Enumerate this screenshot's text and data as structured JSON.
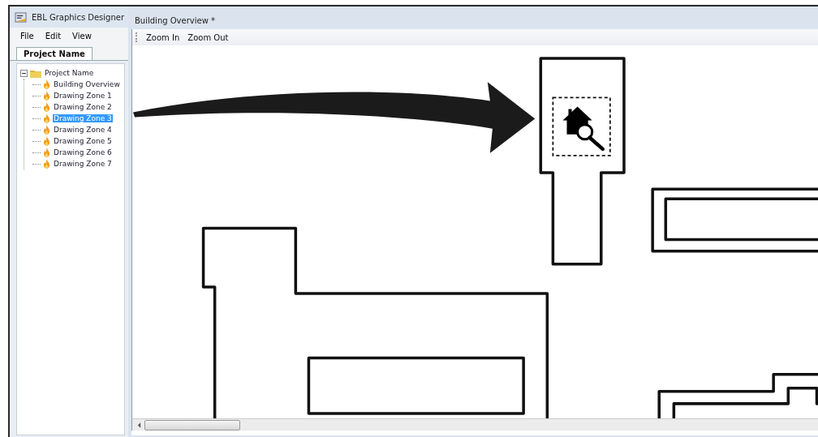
{
  "app": {
    "title": "EBL Graphics Designer",
    "menu": [
      "File",
      "Edit",
      "View"
    ],
    "tabs": [
      {
        "label": "Project Name",
        "selected": true
      }
    ]
  },
  "tree": {
    "label": "Project Name",
    "expanded": true,
    "children": [
      {
        "label": "Building Overview",
        "selected": false
      },
      {
        "label": "Drawing Zone 1",
        "selected": false
      },
      {
        "label": "Drawing Zone 2",
        "selected": false
      },
      {
        "label": "Drawing Zone 3",
        "selected": true
      },
      {
        "label": "Drawing Zone 4",
        "selected": false
      },
      {
        "label": "Drawing Zone 5",
        "selected": false
      },
      {
        "label": "Drawing Zone 6",
        "selected": false
      },
      {
        "label": "Drawing Zone 7",
        "selected": false
      }
    ]
  },
  "document": {
    "title": "Building Overview *",
    "toolbar": [
      "Zoom In",
      "Zoom Out"
    ]
  }
}
